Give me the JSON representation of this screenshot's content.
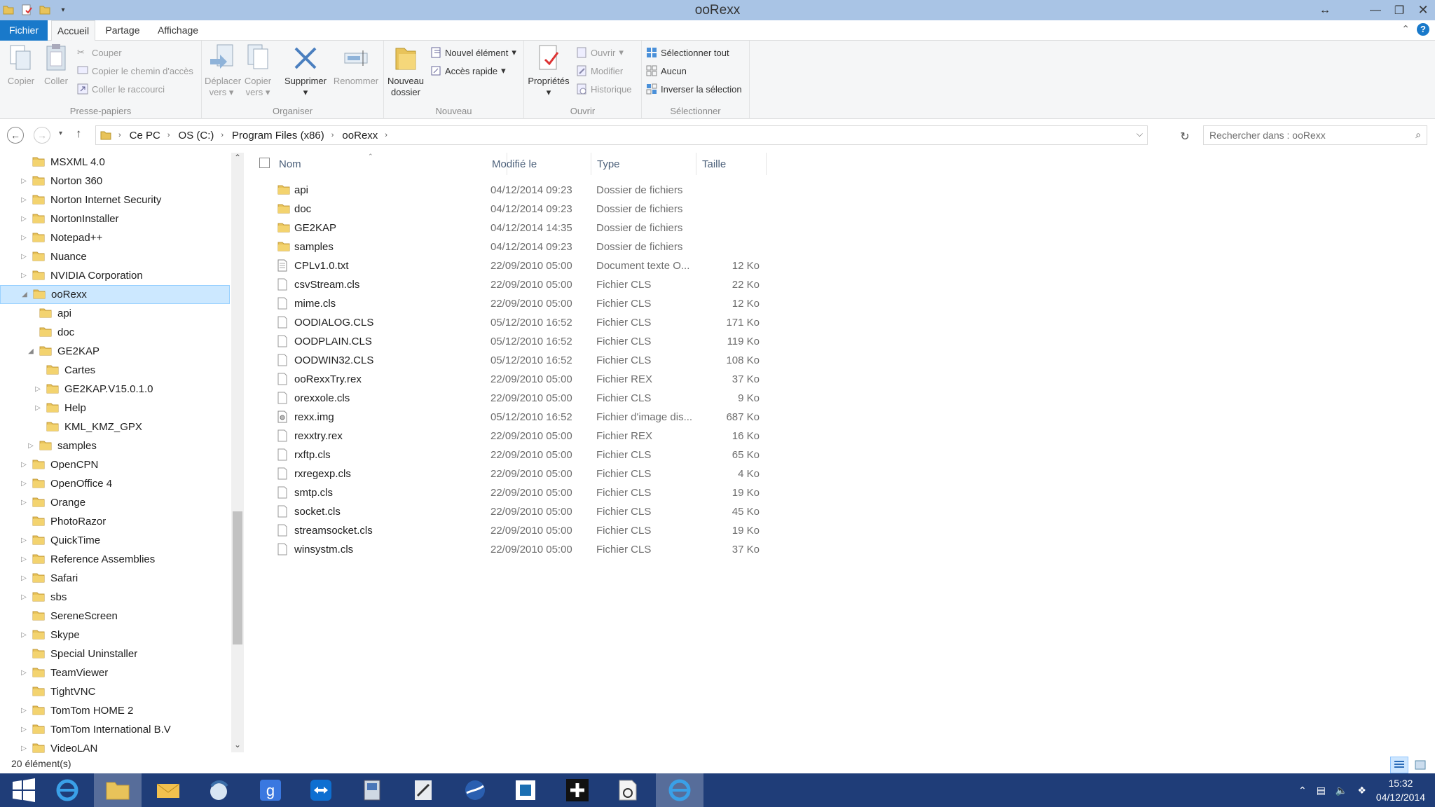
{
  "window": {
    "title": "ooRexx"
  },
  "ribbon_tabs": {
    "file": "Fichier",
    "home": "Accueil",
    "share": "Partage",
    "view": "Affichage"
  },
  "ribbon": {
    "clipboard": {
      "label": "Presse-papiers",
      "copy": "Copier",
      "paste": "Coller",
      "cut": "Couper",
      "copy_path": "Copier le chemin d'accès",
      "paste_shortcut": "Coller le raccourci"
    },
    "organize": {
      "label": "Organiser",
      "move_to_1": "Déplacer",
      "move_to_2": "vers",
      "copy_to_1": "Copier",
      "copy_to_2": "vers",
      "delete": "Supprimer",
      "rename": "Renommer"
    },
    "new": {
      "label": "Nouveau",
      "new_folder_1": "Nouveau",
      "new_folder_2": "dossier",
      "new_item": "Nouvel élément",
      "easy_access": "Accès rapide"
    },
    "open": {
      "label": "Ouvrir",
      "properties": "Propriétés",
      "open": "Ouvrir",
      "edit": "Modifier",
      "history": "Historique"
    },
    "select": {
      "label": "Sélectionner",
      "select_all": "Sélectionner tout",
      "select_none": "Aucun",
      "invert": "Inverser la sélection"
    }
  },
  "address": {
    "crumbs": [
      "Ce PC",
      "OS (C:)",
      "Program Files (x86)",
      "ooRexx"
    ],
    "search_placeholder": "Rechercher dans : ooRexx"
  },
  "tree": [
    {
      "label": "MSXML 4.0",
      "level": 0,
      "expander": ""
    },
    {
      "label": "Norton 360",
      "level": 0,
      "expander": "▷"
    },
    {
      "label": "Norton Internet Security",
      "level": 0,
      "expander": "▷"
    },
    {
      "label": "NortonInstaller",
      "level": 0,
      "expander": "▷"
    },
    {
      "label": "Notepad++",
      "level": 0,
      "expander": "▷"
    },
    {
      "label": "Nuance",
      "level": 0,
      "expander": "▷"
    },
    {
      "label": "NVIDIA Corporation",
      "level": 0,
      "expander": "▷"
    },
    {
      "label": "ooRexx",
      "level": 0,
      "expander": "◢",
      "selected": true
    },
    {
      "label": "api",
      "level": 1,
      "expander": ""
    },
    {
      "label": "doc",
      "level": 1,
      "expander": ""
    },
    {
      "label": "GE2KAP",
      "level": 1,
      "expander": "◢"
    },
    {
      "label": "Cartes",
      "level": 2,
      "expander": ""
    },
    {
      "label": "GE2KAP.V15.0.1.0",
      "level": 2,
      "expander": "▷"
    },
    {
      "label": "Help",
      "level": 2,
      "expander": "▷"
    },
    {
      "label": "KML_KMZ_GPX",
      "level": 2,
      "expander": ""
    },
    {
      "label": "samples",
      "level": 1,
      "expander": "▷"
    },
    {
      "label": "OpenCPN",
      "level": 0,
      "expander": "▷"
    },
    {
      "label": "OpenOffice 4",
      "level": 0,
      "expander": "▷"
    },
    {
      "label": "Orange",
      "level": 0,
      "expander": "▷"
    },
    {
      "label": "PhotoRazor",
      "level": 0,
      "expander": ""
    },
    {
      "label": "QuickTime",
      "level": 0,
      "expander": "▷"
    },
    {
      "label": "Reference Assemblies",
      "level": 0,
      "expander": "▷"
    },
    {
      "label": "Safari",
      "level": 0,
      "expander": "▷"
    },
    {
      "label": "sbs",
      "level": 0,
      "expander": "▷"
    },
    {
      "label": "SereneScreen",
      "level": 0,
      "expander": ""
    },
    {
      "label": "Skype",
      "level": 0,
      "expander": "▷"
    },
    {
      "label": "Special Uninstaller",
      "level": 0,
      "expander": ""
    },
    {
      "label": "TeamViewer",
      "level": 0,
      "expander": "▷"
    },
    {
      "label": "TightVNC",
      "level": 0,
      "expander": ""
    },
    {
      "label": "TomTom HOME 2",
      "level": 0,
      "expander": "▷"
    },
    {
      "label": "TomTom International B.V",
      "level": 0,
      "expander": "▷"
    },
    {
      "label": "VideoLAN",
      "level": 0,
      "expander": "▷"
    }
  ],
  "columns": {
    "name": "Nom",
    "modified": "Modifié le",
    "type": "Type",
    "size": "Taille"
  },
  "files": [
    {
      "name": "api",
      "modified": "04/12/2014 09:23",
      "type": "Dossier de fichiers",
      "size": "",
      "kind": "folder"
    },
    {
      "name": "doc",
      "modified": "04/12/2014 09:23",
      "type": "Dossier de fichiers",
      "size": "",
      "kind": "folder"
    },
    {
      "name": "GE2KAP",
      "modified": "04/12/2014 14:35",
      "type": "Dossier de fichiers",
      "size": "",
      "kind": "folder"
    },
    {
      "name": "samples",
      "modified": "04/12/2014 09:23",
      "type": "Dossier de fichiers",
      "size": "",
      "kind": "folder"
    },
    {
      "name": "CPLv1.0.txt",
      "modified": "22/09/2010 05:00",
      "type": "Document texte O...",
      "size": "12 Ko",
      "kind": "text"
    },
    {
      "name": "csvStream.cls",
      "modified": "22/09/2010 05:00",
      "type": "Fichier CLS",
      "size": "22 Ko",
      "kind": "file"
    },
    {
      "name": "mime.cls",
      "modified": "22/09/2010 05:00",
      "type": "Fichier CLS",
      "size": "12 Ko",
      "kind": "file"
    },
    {
      "name": "OODIALOG.CLS",
      "modified": "05/12/2010 16:52",
      "type": "Fichier CLS",
      "size": "171 Ko",
      "kind": "file"
    },
    {
      "name": "OODPLAIN.CLS",
      "modified": "05/12/2010 16:52",
      "type": "Fichier CLS",
      "size": "119 Ko",
      "kind": "file"
    },
    {
      "name": "OODWIN32.CLS",
      "modified": "05/12/2010 16:52",
      "type": "Fichier CLS",
      "size": "108 Ko",
      "kind": "file"
    },
    {
      "name": "ooRexxTry.rex",
      "modified": "22/09/2010 05:00",
      "type": "Fichier REX",
      "size": "37 Ko",
      "kind": "file"
    },
    {
      "name": "orexxole.cls",
      "modified": "22/09/2010 05:00",
      "type": "Fichier CLS",
      "size": "9 Ko",
      "kind": "file"
    },
    {
      "name": "rexx.img",
      "modified": "05/12/2010 16:52",
      "type": "Fichier d'image dis...",
      "size": "687 Ko",
      "kind": "image"
    },
    {
      "name": "rexxtry.rex",
      "modified": "22/09/2010 05:00",
      "type": "Fichier REX",
      "size": "16 Ko",
      "kind": "file"
    },
    {
      "name": "rxftp.cls",
      "modified": "22/09/2010 05:00",
      "type": "Fichier CLS",
      "size": "65 Ko",
      "kind": "file"
    },
    {
      "name": "rxregexp.cls",
      "modified": "22/09/2010 05:00",
      "type": "Fichier CLS",
      "size": "4 Ko",
      "kind": "file"
    },
    {
      "name": "smtp.cls",
      "modified": "22/09/2010 05:00",
      "type": "Fichier CLS",
      "size": "19 Ko",
      "kind": "file"
    },
    {
      "name": "socket.cls",
      "modified": "22/09/2010 05:00",
      "type": "Fichier CLS",
      "size": "45 Ko",
      "kind": "file"
    },
    {
      "name": "streamsocket.cls",
      "modified": "22/09/2010 05:00",
      "type": "Fichier CLS",
      "size": "19 Ko",
      "kind": "file"
    },
    {
      "name": "winsystm.cls",
      "modified": "22/09/2010 05:00",
      "type": "Fichier CLS",
      "size": "37 Ko",
      "kind": "file"
    }
  ],
  "status": {
    "count": "20 élément(s)"
  },
  "taskbar": {
    "apps": [
      "start-icon",
      "internet-explorer-icon",
      "file-explorer-icon",
      "outlook-icon",
      "thunderbird-icon",
      "google-icon",
      "teamviewer-icon",
      "scanner-icon",
      "notepad-icon",
      "google-earth-icon",
      "app-icon",
      "plus-icon",
      "openoffice-icon",
      "internet-explorer-icon"
    ],
    "time": "15:32",
    "date": "04/12/2014"
  },
  "colors": {
    "accent": "#1979ca",
    "title_bar": "#a9c4e5",
    "taskbar": "#1f3d78",
    "selection": "#cce8ff",
    "folder": "#e8c35a"
  }
}
